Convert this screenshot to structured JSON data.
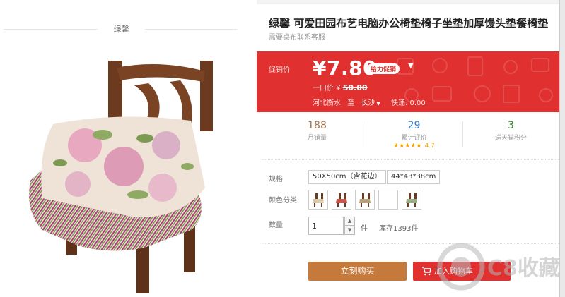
{
  "shop": {
    "name": "绿馨"
  },
  "product": {
    "title": "绿馨 可爱田园布艺电脑办公椅垫椅子坐垫加厚馒头垫餐椅垫",
    "subtitle": "需要桌布联系客服"
  },
  "promo": {
    "label": "促销价",
    "price": "¥7.80",
    "badge": "给力促销",
    "original_label": "一口价 ¥",
    "original_price": "50.00",
    "ship_from": "河北衡水",
    "ship_to_word": "至",
    "ship_to": "长沙",
    "shipping": "快递: 0.00"
  },
  "stats": {
    "sales": {
      "value": "188",
      "label": "月销量"
    },
    "reviews": {
      "value": "29",
      "label": "累计评价",
      "stars": "★★★★★",
      "rating": "4.7"
    },
    "points": {
      "value": "3",
      "label": "送天猫积分"
    }
  },
  "spec": {
    "label": "规格",
    "options": [
      "50X50cm（含花边）",
      "44*43*38cm"
    ]
  },
  "colors": {
    "label": "颜色分类"
  },
  "quantity": {
    "label": "数量",
    "value": "1",
    "unit": "件",
    "stock": "库存1393件"
  },
  "actions": {
    "buy_now": "立刻购买",
    "add_to_cart": "加入购物车"
  },
  "watermark": {
    "text": "C8收藏"
  },
  "palette": {
    "promo_red": "#e0302f",
    "buy_brown": "#c57a3c",
    "reviews_blue": "#3a7bc8",
    "points_green": "#2f8a2f"
  }
}
